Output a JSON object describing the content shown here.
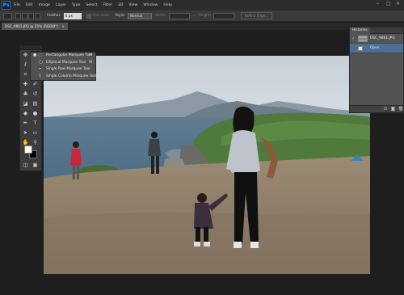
{
  "app": {
    "logo": "Ps",
    "window_controls": [
      "–",
      "□",
      "×"
    ]
  },
  "menu": [
    "File",
    "Edit",
    "Image",
    "Layer",
    "Type",
    "Select",
    "Filter",
    "3D",
    "View",
    "Window",
    "Help"
  ],
  "options": {
    "feather_label": "Feather:",
    "feather_value": "0 px",
    "anti_alias_label": "Anti-alias",
    "style_label": "Style:",
    "style_value": "Normal",
    "width_label": "Width:",
    "height_label": "Height:",
    "refine_label": "Refine Edge..."
  },
  "document": {
    "tab_title": "DSC_9861.JPG @ 25% (RGB/8*)"
  },
  "flyout": {
    "items": [
      {
        "label": "Rectangular Marquee Tool",
        "key": "M",
        "selected": true
      },
      {
        "label": "Elliptical Marquee Tool",
        "key": "M",
        "selected": false
      },
      {
        "label": "Single Row Marquee Tool",
        "key": "",
        "selected": false
      },
      {
        "label": "Single Column Marquee Tool",
        "key": "",
        "selected": false
      }
    ]
  },
  "colors": {
    "foreground": "#ffffff",
    "background": "#000000",
    "selection": "#4a6f97"
  },
  "layers_panel": {
    "tab": "Histories",
    "rows": [
      {
        "name": "DSC_9861.JPG",
        "thumb": "photo",
        "selected": false
      },
      {
        "name": "Open",
        "thumb": "white",
        "selected": true
      }
    ]
  }
}
